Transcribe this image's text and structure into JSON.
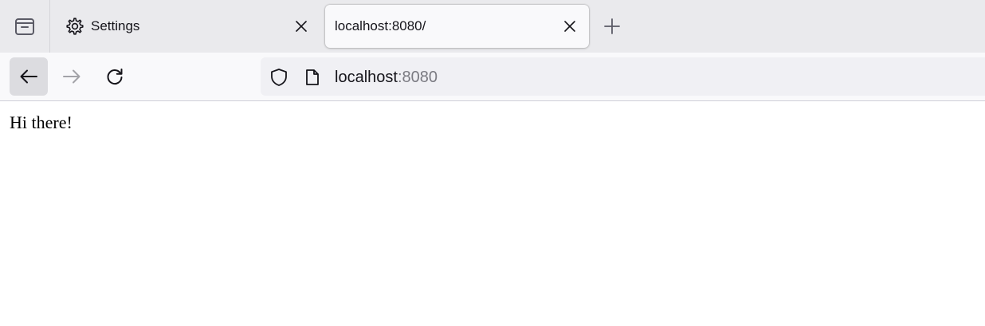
{
  "colors": {
    "tabstrip_bg": "#eaeaed",
    "active_tab_bg": "#f9f9fb",
    "navbar_bg": "#f9f9fb",
    "urlbar_bg": "#f0f0f4",
    "text_primary": "#15141a",
    "text_muted": "#7b7b82",
    "forward_disabled": "#a3a3a8"
  },
  "tabstrip": {
    "overview_icon": "tab-overview-icon",
    "tabs": [
      {
        "label": "Settings",
        "icon": "gear-icon",
        "active": false,
        "close_icon": "close-icon"
      },
      {
        "label": "localhost:8080/",
        "icon": null,
        "active": true,
        "close_icon": "close-icon"
      }
    ],
    "new_tab_icon": "plus-icon"
  },
  "navbar": {
    "back_icon": "arrow-left-icon",
    "forward_icon": "arrow-right-icon",
    "reload_icon": "reload-icon",
    "urlbar": {
      "shield_icon": "shield-icon",
      "page_icon": "page-icon",
      "host": "localhost",
      "port": ":8080"
    }
  },
  "page": {
    "text": "Hi there!"
  }
}
